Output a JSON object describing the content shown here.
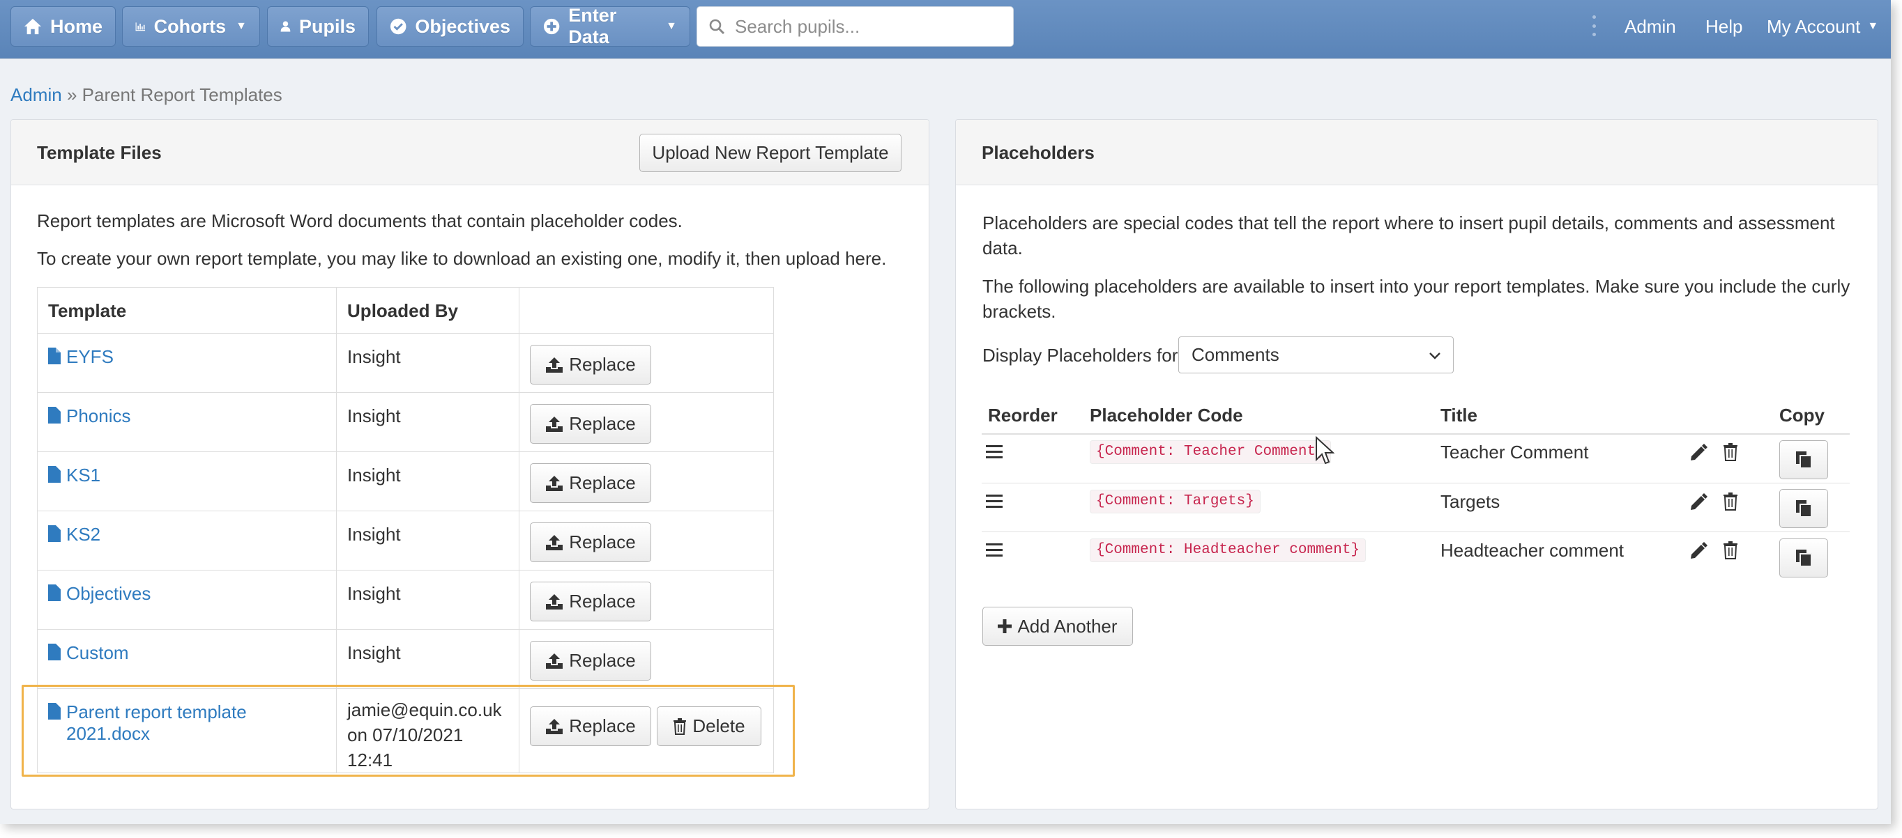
{
  "nav": {
    "home": "Home",
    "cohorts": "Cohorts",
    "pupils": "Pupils",
    "objectives": "Objectives",
    "enter_data": "Enter Data",
    "search_placeholder": "Search pupils...",
    "admin": "Admin",
    "help": "Help",
    "my_account": "My Account"
  },
  "breadcrumb": {
    "parent": "Admin",
    "separator": "»",
    "current": "Parent Report Templates"
  },
  "template_files": {
    "title": "Template Files",
    "upload_button": "Upload New Report Template",
    "intro_1": "Report templates are Microsoft Word documents that contain placeholder codes.",
    "intro_2": "To create your own report template, you may like to download an existing one, modify it, then upload here.",
    "columns": [
      "Template",
      "Uploaded By",
      ""
    ],
    "rows": [
      {
        "name": "EYFS",
        "uploaded_by": "Insight",
        "uploaded_on": "",
        "replace": "Replace"
      },
      {
        "name": "Phonics",
        "uploaded_by": "Insight",
        "uploaded_on": "",
        "replace": "Replace"
      },
      {
        "name": "KS1",
        "uploaded_by": "Insight",
        "uploaded_on": "",
        "replace": "Replace"
      },
      {
        "name": "KS2",
        "uploaded_by": "Insight",
        "uploaded_on": "",
        "replace": "Replace"
      },
      {
        "name": "Objectives",
        "uploaded_by": "Insight",
        "uploaded_on": "",
        "replace": "Replace"
      },
      {
        "name": "Custom",
        "uploaded_by": "Insight",
        "uploaded_on": "",
        "replace": "Replace"
      },
      {
        "name": "Parent report template 2021.docx",
        "uploaded_by": "jamie@equin.co.uk",
        "uploaded_on": "on 07/10/2021 12:41",
        "replace": "Replace",
        "delete": "Delete"
      }
    ],
    "highlight_color": "#f0b34a"
  },
  "placeholders": {
    "title": "Placeholders",
    "intro_1a": "Placeholders are special codes that tell the report where to insert pupil details, comments and assessment",
    "intro_1b": "data.",
    "intro_2a": "The following placeholders are available to insert into your report templates. Make sure you include the curly",
    "intro_2b": "brackets.",
    "display_label": "Display Placeholders for",
    "display_value": "Comments",
    "columns": {
      "reorder": "Reorder",
      "code": "Placeholder Code",
      "title": "Title",
      "copy": "Copy"
    },
    "rows": [
      {
        "code": "{Comment: Teacher Comment}",
        "title": "Teacher Comment"
      },
      {
        "code": "{Comment: Targets}",
        "title": "Targets"
      },
      {
        "code": "{Comment: Headteacher comment}",
        "title": "Headteacher comment"
      }
    ],
    "add_button": "Add Another"
  },
  "colors": {
    "navbar": "#5f89bd",
    "link": "#2f7bbf",
    "code_text": "#c7254e",
    "code_bg": "#f9f2f4"
  }
}
